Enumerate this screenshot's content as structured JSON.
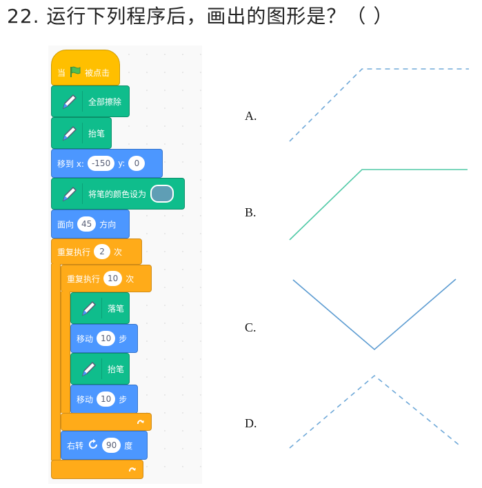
{
  "question": {
    "text": "22. 运行下列程序后，画出的图形是？（  ）"
  },
  "script": {
    "when_flag_prefix": "当",
    "when_flag_suffix": "被点击",
    "erase_all": "全部擦除",
    "pen_up_1": "抬笔",
    "goto_label": "移到 x:",
    "goto_x": "-150",
    "goto_y_label": "y:",
    "goto_y": "0",
    "set_color_label": "将笔的颜色设为",
    "pen_color": "#5f9eb5",
    "point_prefix": "面向",
    "point_value": "45",
    "point_suffix": "方向",
    "repeat_outer_label": "重复执行",
    "repeat_outer_value": "2",
    "repeat_outer_suffix": "次",
    "repeat_inner_label": "重复执行",
    "repeat_inner_value": "10",
    "repeat_inner_suffix": "次",
    "pen_down": "落笔",
    "move1_label": "移动",
    "move1_value": "10",
    "move1_suffix": "步",
    "pen_up_2": "抬笔",
    "move2_label": "移动",
    "move2_value": "10",
    "move2_suffix": "步",
    "turn_label": "右转",
    "turn_value": "90",
    "turn_suffix": "度"
  },
  "options": [
    {
      "label": "A.",
      "style": "dashed",
      "color": "#6ea8d8"
    },
    {
      "label": "B.",
      "style": "solid",
      "color": "#4fc9a6"
    },
    {
      "label": "C.",
      "style": "solid",
      "color": "#5b9bd1"
    },
    {
      "label": "D.",
      "style": "dashed",
      "color": "#6ea8d8"
    }
  ],
  "colors": {
    "events": "#ffbf00",
    "pen": "#0fbd8c",
    "motion": "#4c97ff",
    "control": "#ffab19"
  }
}
